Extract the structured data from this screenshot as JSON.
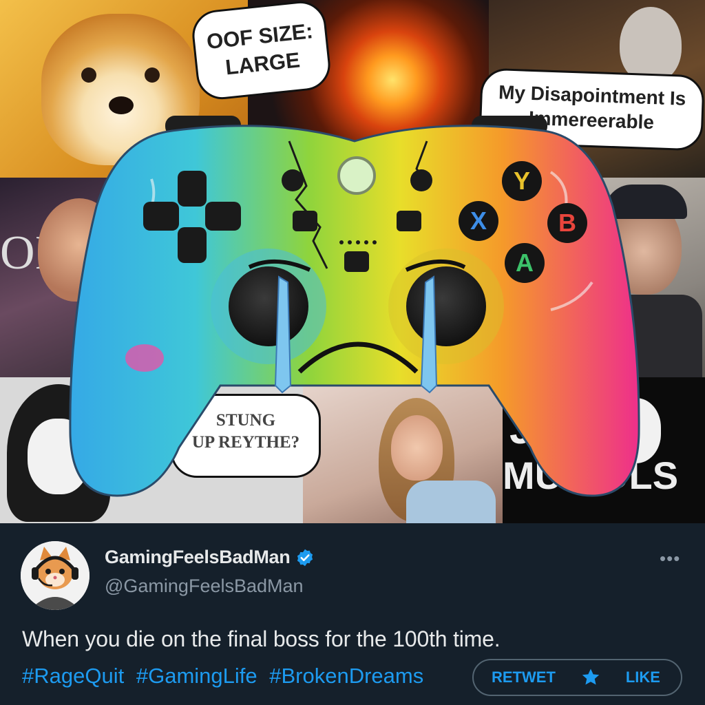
{
  "media": {
    "bubble_top_left": [
      "OOF SIZE:",
      "LARGE"
    ],
    "bubble_top_right": [
      "My Disapointment Is",
      "Immereerable"
    ],
    "bubble_bottom_left": [
      "STUNG",
      "UP REYTHE?"
    ],
    "poster_bottom_right": [
      "J   ON",
      "MU   POLS"
    ],
    "poster_left": "OI",
    "controller_buttons": {
      "y": "Y",
      "x": "X",
      "b": "B",
      "a": "A"
    },
    "colors": {
      "btn_y": "#e9c22b",
      "btn_x": "#3d8ee8",
      "btn_b": "#e8453c",
      "btn_a": "#3cc26a"
    }
  },
  "tweet": {
    "display_name": "GamingFeelsBadMan",
    "handle": "@GamingFeelsBadMan",
    "more_icon": "more-icon",
    "text": "When you die on the final boss for the 100th time.",
    "hashtags": [
      "#RageQuit",
      "#GamingLife",
      "#BrokenDreams"
    ],
    "actions": {
      "retweet_label": "RETWET",
      "like_label": "LIKE"
    },
    "colors": {
      "accent": "#1d9bf0",
      "background": "#15202b",
      "muted": "#8b98a5"
    }
  }
}
